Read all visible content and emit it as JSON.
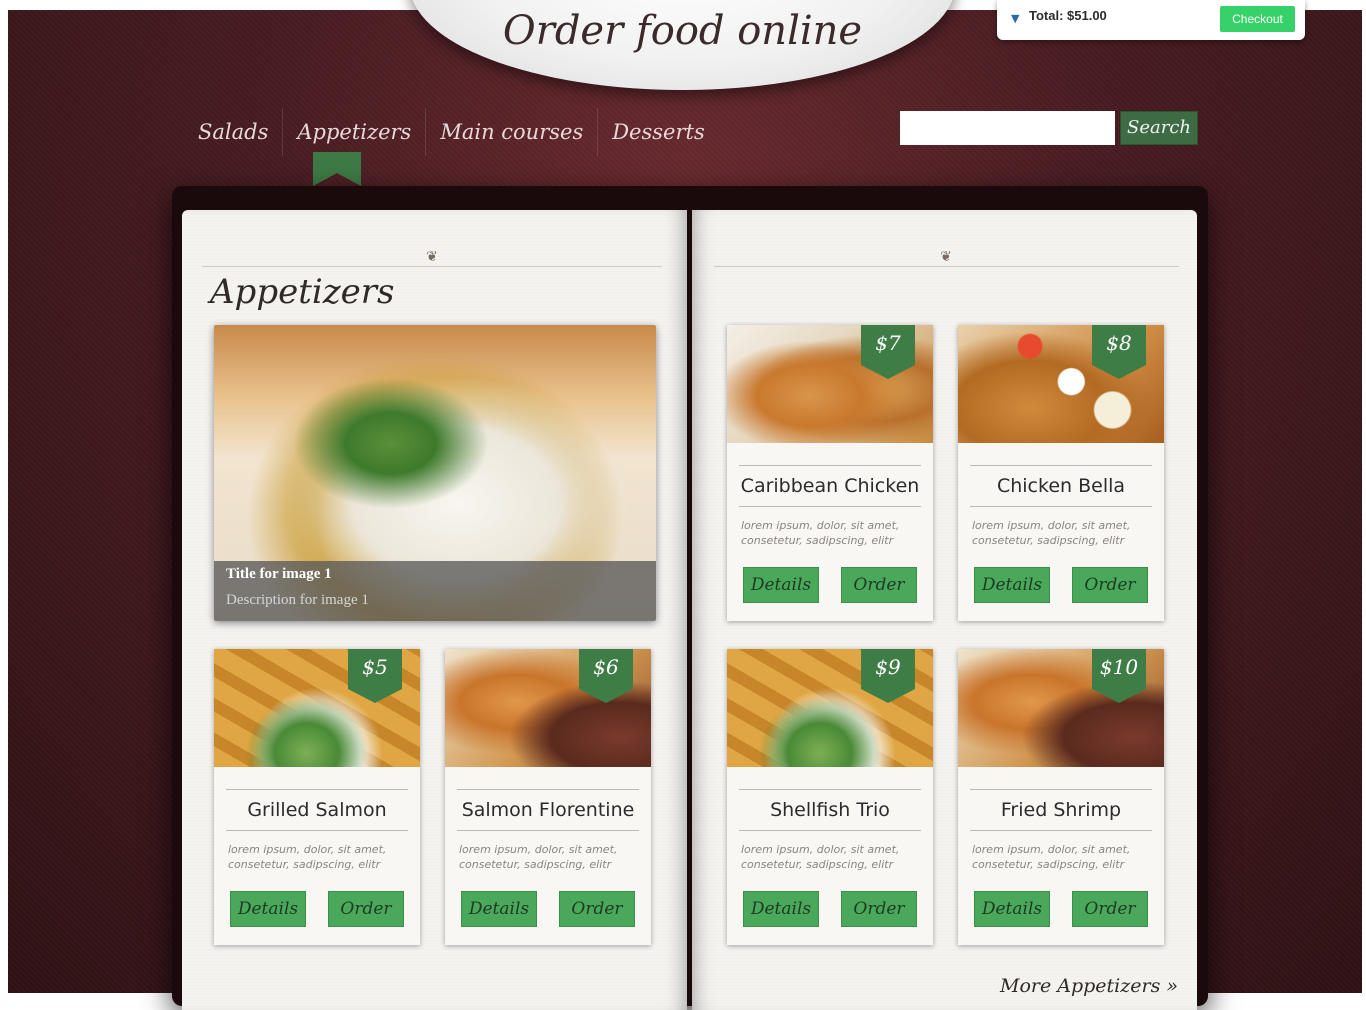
{
  "header": {
    "title": "Order food online"
  },
  "cart": {
    "total": "Total: $51.00",
    "checkout_label": "Checkout"
  },
  "nav": {
    "items": [
      {
        "label": "Salads"
      },
      {
        "label": "Appetizers"
      },
      {
        "label": "Main courses"
      },
      {
        "label": "Desserts"
      }
    ],
    "active": "Appetizers"
  },
  "search": {
    "value": "",
    "button_label": "Search"
  },
  "section": {
    "title": "Appetizers"
  },
  "slider": {
    "title": "Title for image 1",
    "description": "Description for image 1"
  },
  "items": [
    {
      "name": "Caribbean Chicken",
      "price": "$7",
      "desc": "lorem ipsum, dolor, sit amet, consetetur, sadipscing, elitr",
      "details": "Details",
      "order": "Order"
    },
    {
      "name": "Chicken Bella",
      "price": "$8",
      "desc": "lorem ipsum, dolor, sit amet, consetetur, sadipscing, elitr",
      "details": "Details",
      "order": "Order"
    },
    {
      "name": "Grilled Salmon",
      "price": "$5",
      "desc": "lorem ipsum, dolor, sit amet, consetetur, sadipscing, elitr",
      "details": "Details",
      "order": "Order"
    },
    {
      "name": "Salmon Florentine",
      "price": "$6",
      "desc": "lorem ipsum, dolor, sit amet, consetetur, sadipscing, elitr",
      "details": "Details",
      "order": "Order"
    },
    {
      "name": "Shellfish Trio",
      "price": "$9",
      "desc": "lorem ipsum, dolor, sit amet, consetetur, sadipscing, elitr",
      "details": "Details",
      "order": "Order"
    },
    {
      "name": "Fried Shrimp",
      "price": "$10",
      "desc": "lorem ipsum, dolor, sit amet, consetetur, sadipscing, elitr",
      "details": "Details",
      "order": "Order"
    }
  ],
  "more_link": "More Appetizers »",
  "colors": {
    "background": "#4a1d22",
    "accent_green": "#4aa85b",
    "ribbon_green": "#3f7d47",
    "checkout_green": "#37d16a"
  }
}
